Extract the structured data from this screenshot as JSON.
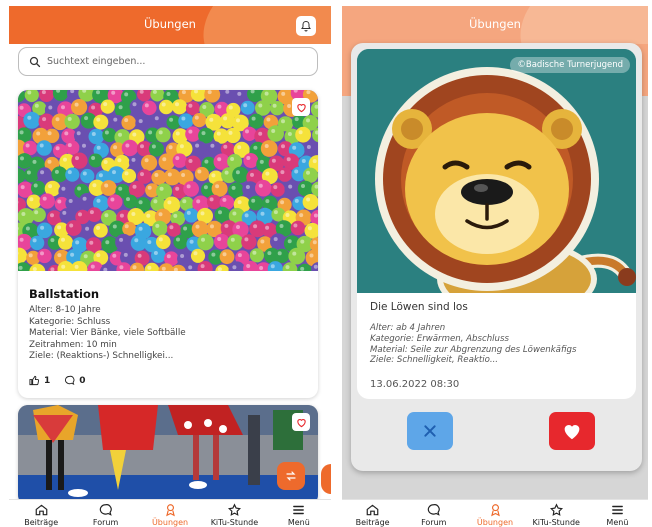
{
  "left": {
    "header": {
      "title": "Übungen"
    },
    "search": {
      "placeholder": "Suchtext eingeben..."
    },
    "card": {
      "title": "Ballstation",
      "meta": [
        "Alter: 8-10 Jahre",
        "Kategorie: Schluss",
        "Material: Vier Bänke, viele Softbälle",
        "Zeitrahmen: 10 min",
        "Ziele: (Reaktions-) Schnelligkei..."
      ],
      "likes": "1",
      "comments": "0"
    }
  },
  "right": {
    "header": {
      "title": "Übungen"
    },
    "card": {
      "copyright": "©Badische Turnerjugend",
      "title": "Die Löwen sind los",
      "meta": [
        "Alter: ab 4 Jahren",
        "Kategorie: Erwärmen, Abschluss",
        "Material: Seile zur Abgrenzung des Löwenkäfigs",
        "Ziele: Schnelligkeit, Reaktio..."
      ],
      "date": "13.06.2022 08:30"
    }
  },
  "nav": [
    {
      "label": "Beiträge",
      "icon": "home-icon"
    },
    {
      "label": "Forum",
      "icon": "forum-icon"
    },
    {
      "label": "Übungen",
      "icon": "exercise-icon",
      "active": true
    },
    {
      "label": "KiTu-Stunde",
      "icon": "star-icon"
    },
    {
      "label": "Menü",
      "icon": "menu-icon"
    }
  ],
  "colors": {
    "accent": "#ee6a2c",
    "accent_light": "#f28a4e",
    "like_red": "#e7282d",
    "dislike_blue": "#5ea6e8",
    "lion_bg": "#2b8080"
  }
}
